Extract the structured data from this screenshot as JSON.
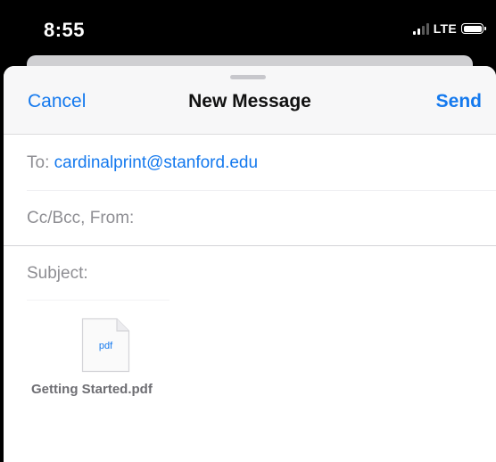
{
  "status_bar": {
    "time": "8:55",
    "network": "LTE",
    "icons": [
      "signal-bars-icon",
      "battery-icon"
    ]
  },
  "nav": {
    "cancel_label": "Cancel",
    "title": "New Message",
    "send_label": "Send"
  },
  "fields": {
    "to_label": "To:",
    "to_value": "cardinalprint@stanford.edu",
    "cc_label": "Cc/Bcc, From:",
    "subject_label": "Subject:"
  },
  "attachment": {
    "icon_text": "pdf",
    "filename": "Getting Started.pdf"
  },
  "colors": {
    "accent": "#1479ee",
    "label_gray": "#8e8e93"
  }
}
